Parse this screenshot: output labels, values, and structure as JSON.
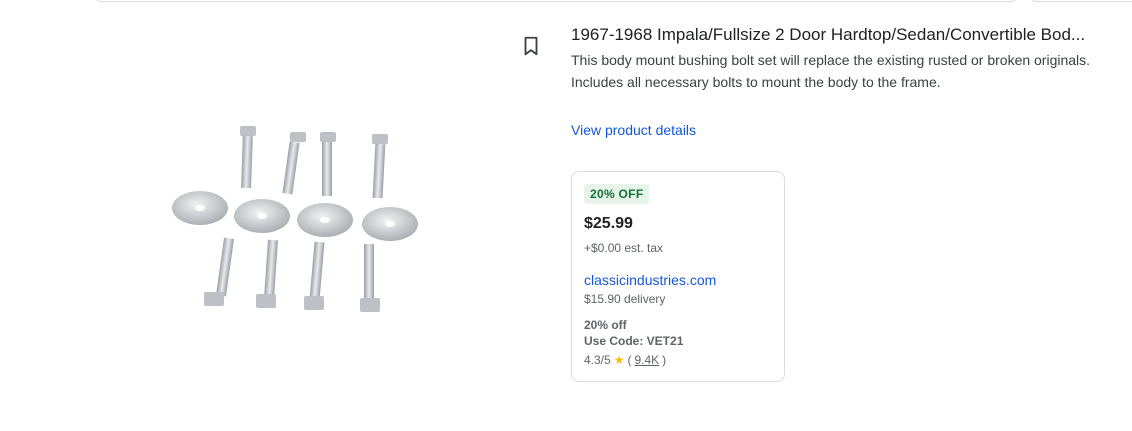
{
  "product": {
    "title": "1967-1968 Impala/Fullsize 2 Door Hardtop/Sedan/Convertible Bod...",
    "description_line1": "This body mount bushing bolt set will replace the existing rusted or broken originals.",
    "description_line2": "Includes all necessary bolts to mount the body to the frame.",
    "details_link": "View product details",
    "image_icon": "bolts-and-washers-image"
  },
  "offer": {
    "badge": "20% OFF",
    "price": "$25.99",
    "tax": "+$0.00 est. tax",
    "store": "classicindustries.com",
    "delivery": "$15.90 delivery",
    "promo_line1": "20% off",
    "promo_line2": "Use Code: VET21",
    "rating": "4.3/5",
    "reviews_open": "(",
    "reviews": "9.4K",
    "reviews_close": ")",
    "colors": {
      "badge_bg": "#e6f4ea",
      "badge_text": "#137333",
      "link": "#1558d6",
      "star": "#fbbc04"
    }
  }
}
